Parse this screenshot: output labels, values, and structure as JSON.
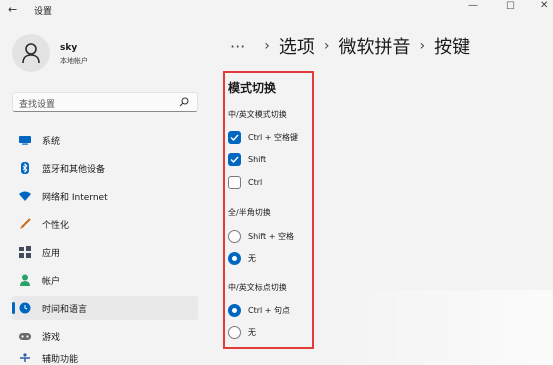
{
  "window": {
    "title": "设置",
    "back_icon": "back-arrow-icon",
    "controls": {
      "minimize": "—",
      "maximize": "☐",
      "close": "✕"
    }
  },
  "profile": {
    "name": "sky",
    "account_type": "本地帐户",
    "avatar_icon": "person-icon"
  },
  "search": {
    "placeholder": "查找设置",
    "icon": "search-icon"
  },
  "sidebar": {
    "items": [
      {
        "label": "系统",
        "icon": "monitor-icon",
        "color": "#0067c0",
        "selected": false
      },
      {
        "label": "蓝牙和其他设备",
        "icon": "bluetooth-icon",
        "color": "#0067c0",
        "selected": false
      },
      {
        "label": "网络和 Internet",
        "icon": "wifi-icon",
        "color": "#0067c0",
        "selected": false
      },
      {
        "label": "个性化",
        "icon": "brush-icon",
        "color": "#c96b1b",
        "selected": false
      },
      {
        "label": "应用",
        "icon": "apps-icon",
        "color": "#444b5a",
        "selected": false
      },
      {
        "label": "帐户",
        "icon": "account-icon",
        "color": "#2aa36b",
        "selected": false
      },
      {
        "label": "时间和语言",
        "icon": "clock-globe-icon",
        "color": "#0067c0",
        "selected": true
      },
      {
        "label": "游戏",
        "icon": "gamepad-icon",
        "color": "#6a6a6a",
        "selected": false
      },
      {
        "label": "辅助功能",
        "icon": "accessibility-icon",
        "color": "#2b5fa8",
        "selected": false
      }
    ]
  },
  "breadcrumb": {
    "ellipsis": "···",
    "separator": "›",
    "items": [
      "选项",
      "微软拼音",
      "按键"
    ]
  },
  "panel": {
    "title": "模式切换",
    "groups": [
      {
        "label": "中/英文模式切换",
        "type": "checkbox",
        "options": [
          {
            "label": "Ctrl + 空格键",
            "checked": true
          },
          {
            "label": "Shift",
            "checked": true
          },
          {
            "label": "Ctrl",
            "checked": false
          }
        ]
      },
      {
        "label": "全/半角切换",
        "type": "radio",
        "options": [
          {
            "label": "Shift + 空格",
            "checked": false
          },
          {
            "label": "无",
            "checked": true
          }
        ]
      },
      {
        "label": "中/英文标点切换",
        "type": "radio",
        "options": [
          {
            "label": "Ctrl + 句点",
            "checked": true
          },
          {
            "label": "无",
            "checked": false
          }
        ]
      }
    ]
  },
  "colors": {
    "accent": "#0067c0",
    "highlight_border": "#e33a3a",
    "background": "#f3f3f3"
  }
}
